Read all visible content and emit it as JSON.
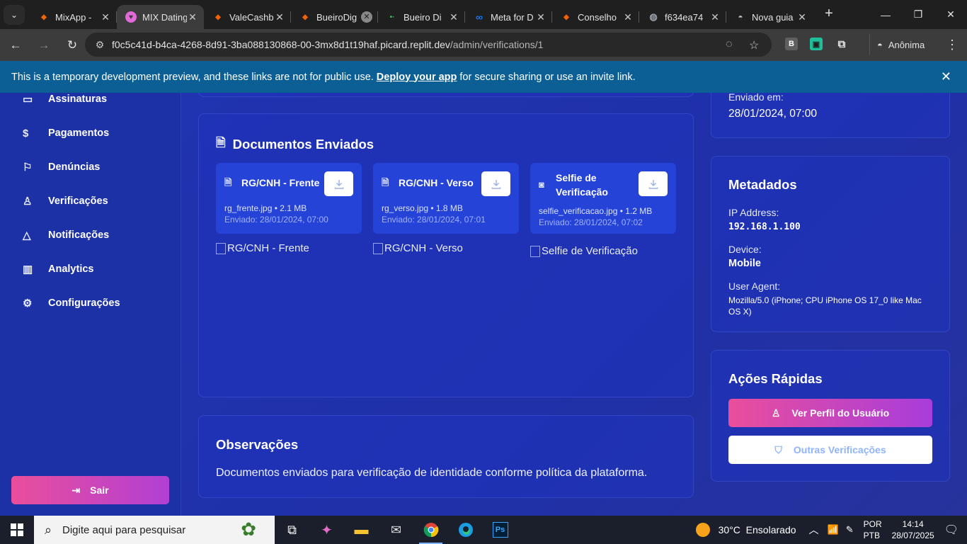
{
  "browser": {
    "tabs": [
      {
        "title": "MixApp -",
        "favicon": "replit-icon",
        "color": "#f26207",
        "active": false
      },
      {
        "title": "MIX Dating",
        "favicon": "heart-pin-icon",
        "color": "#e26ad8",
        "active": true
      },
      {
        "title": "ValeCashb",
        "favicon": "replit-icon",
        "color": "#f26207",
        "active": false
      },
      {
        "title": "BueiroDig",
        "favicon": "replit-icon",
        "color": "#f26207",
        "active": false
      },
      {
        "title": "Bueiro Di",
        "favicon": "dots-icon",
        "color": "#33c24d",
        "active": false
      },
      {
        "title": "Meta for D",
        "favicon": "meta-icon",
        "color": "#1877f2",
        "active": false
      },
      {
        "title": "Conselho",
        "favicon": "replit-icon",
        "color": "#f26207",
        "active": false
      },
      {
        "title": "f634ea74",
        "favicon": "globe-icon",
        "color": "#9aa0a6",
        "active": false
      },
      {
        "title": "Nova guia",
        "favicon": "incognito-icon",
        "color": "#bdbdbd",
        "active": false
      }
    ],
    "url_host": "f0c5c41d-b4ca-4268-8d91-3ba088130868-00-3mx8d1t19haf.picard.replit.dev",
    "url_path": "/admin/verifications/1",
    "profile_label": "Anônima"
  },
  "banner": {
    "text_before": "This is a temporary development preview, and these links are not for public use.",
    "link": "Deploy your app",
    "text_after": "for secure sharing or use an invite link."
  },
  "sidebar": {
    "items": [
      {
        "label": "Assinaturas",
        "icon": "card-icon"
      },
      {
        "label": "Pagamentos",
        "icon": "dollar-icon"
      },
      {
        "label": "Denúncias",
        "icon": "flag-icon"
      },
      {
        "label": "Verificações",
        "icon": "user-check-icon"
      },
      {
        "label": "Notificações",
        "icon": "bell-icon"
      },
      {
        "label": "Analytics",
        "icon": "bar-chart-icon"
      },
      {
        "label": "Configurações",
        "icon": "gear-icon"
      }
    ],
    "logout_label": "Sair"
  },
  "documents": {
    "title": "Documentos Enviados",
    "items": [
      {
        "name": "RG/CNH - Frente",
        "file": "rg_frente.jpg • 2.1 MB",
        "sent": "Enviado: 28/01/2024, 07:00",
        "alt": "RG/CNH - Frente",
        "icon": "file-icon"
      },
      {
        "name": "RG/CNH - Verso",
        "file": "rg_verso.jpg • 1.8 MB",
        "sent": "Enviado: 28/01/2024, 07:01",
        "alt": "RG/CNH - Verso",
        "icon": "file-icon"
      },
      {
        "name_line1": "Selfie de",
        "name_line2": "Verificação",
        "file": "selfie_verificacao.jpg • 1.2 MB",
        "sent": "Enviado: 28/01/2024, 07:02",
        "alt": "Selfie de Verificação",
        "icon": "camera-icon"
      }
    ]
  },
  "observations": {
    "title": "Observações",
    "text": "Documentos enviados para verificação de identidade conforme política da plataforma."
  },
  "sent_info": {
    "label": "Enviado em:",
    "value": "28/01/2024, 07:00"
  },
  "metadata": {
    "title": "Metadados",
    "ip_label": "IP Address:",
    "ip_value": "192.168.1.100",
    "device_label": "Device:",
    "device_value": "Mobile",
    "ua_label": "User Agent:",
    "ua_value": "Mozilla/5.0 (iPhone; CPU iPhone OS 17_0 like Mac OS X)"
  },
  "quick_actions": {
    "title": "Ações Rápidas",
    "view_profile": "Ver Perfil do Usuário",
    "other_verifications": "Outras Verificações"
  },
  "taskbar": {
    "search_placeholder": "Digite aqui para pesquisar",
    "weather": "30°C  Ensolarado",
    "lang_line1": "POR",
    "lang_line2": "PTB",
    "time": "14:14",
    "date": "28/07/2025"
  }
}
